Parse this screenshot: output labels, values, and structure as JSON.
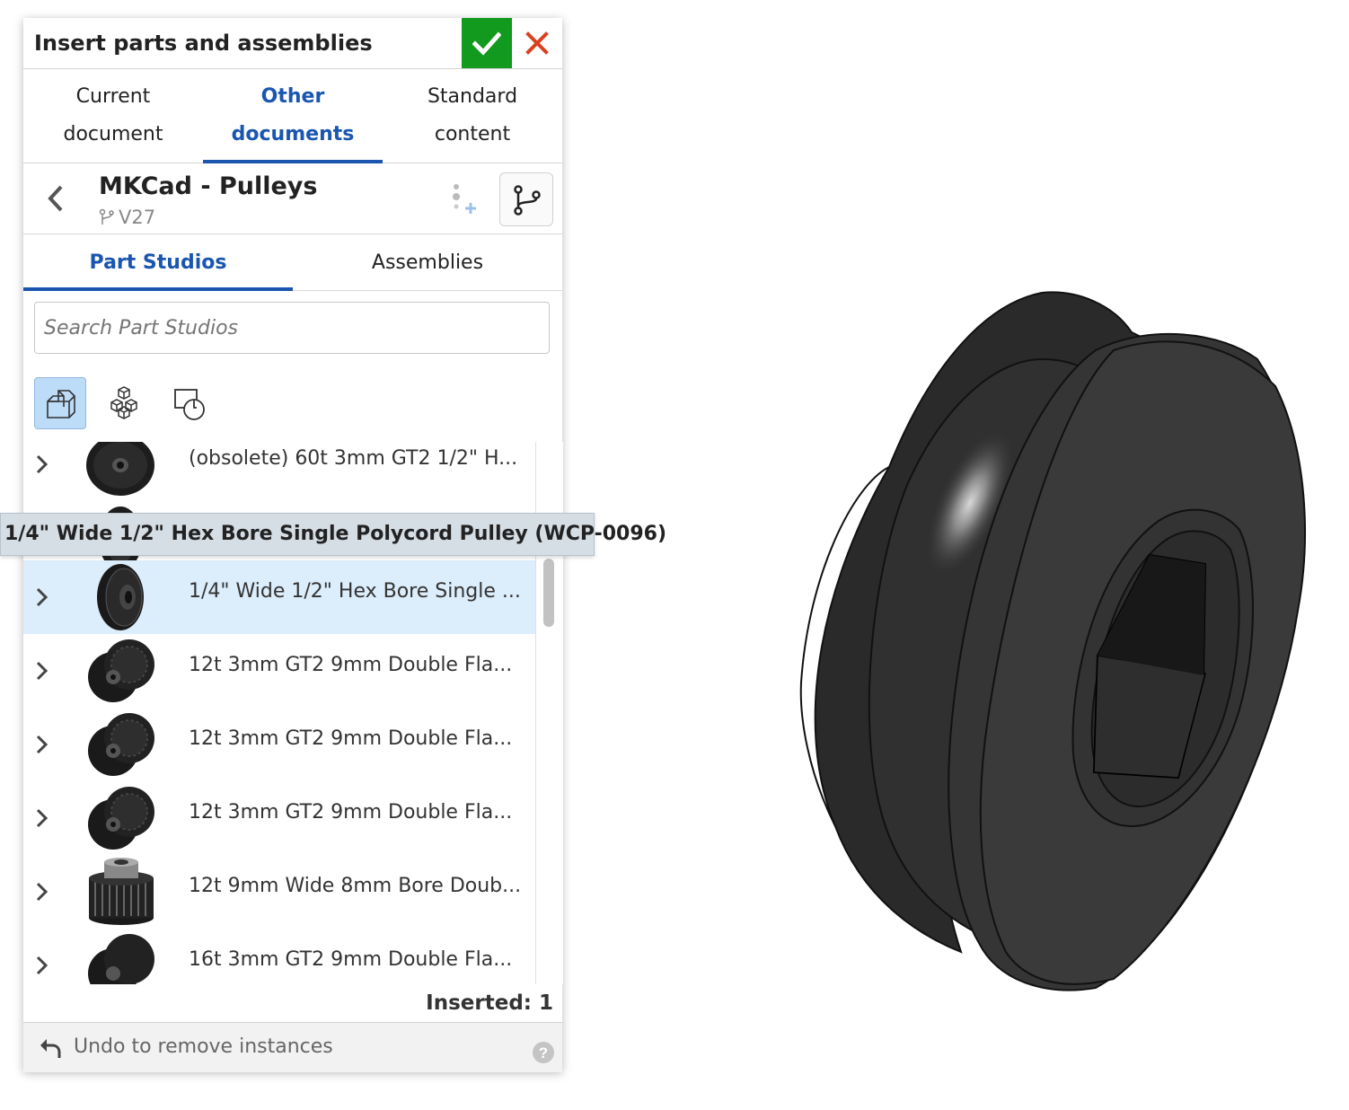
{
  "dialog": {
    "title": "Insert parts and assemblies",
    "confirm_icon": "checkmark-icon",
    "close_icon": "close-x-icon",
    "accent_confirm": "#129a1e",
    "accent_close": "#d9411e"
  },
  "source_tabs": [
    {
      "line1": "Current",
      "line2": "document",
      "active": false
    },
    {
      "line1": "Other",
      "line2": "documents",
      "active": true
    },
    {
      "line1": "Standard",
      "line2": "content",
      "active": false
    }
  ],
  "document": {
    "name": "MKCad - Pulleys",
    "version": "V27"
  },
  "sub_tabs": [
    {
      "label": "Part Studios",
      "active": true
    },
    {
      "label": "Assemblies",
      "active": false
    }
  ],
  "search": {
    "placeholder": "Search Part Studios"
  },
  "filters": [
    {
      "icon": "part-icon",
      "active": true
    },
    {
      "icon": "assembly-cubes-icon",
      "active": false
    },
    {
      "icon": "sketch-icon",
      "active": false
    }
  ],
  "items": [
    {
      "label": "(obsolete) 60t 3mm GT2 1/2\" H...",
      "selected": false
    },
    {
      "label": "",
      "selected": false
    },
    {
      "label": "1/4\" Wide 1/2\" Hex Bore Single ...",
      "selected": true
    },
    {
      "label": "12t 3mm GT2 9mm Double Fla...",
      "selected": false
    },
    {
      "label": "12t 3mm GT2 9mm Double Fla...",
      "selected": false
    },
    {
      "label": "12t 3mm GT2 9mm Double Fla...",
      "selected": false
    },
    {
      "label": "12t 9mm Wide 8mm Bore Doub...",
      "selected": false
    },
    {
      "label": "16t 3mm GT2 9mm Double Fla...",
      "selected": false
    }
  ],
  "tooltip": "1/4\" Wide 1/2\" Hex Bore Single Polycord Pulley (WCP-0096)",
  "status": {
    "inserted": "Inserted: 1"
  },
  "footer": {
    "undo_label": "Undo to remove instances",
    "help_icon": "help-question-icon"
  },
  "colors": {
    "active_tab": "#1a56b0",
    "selected_row": "#dcedfb"
  }
}
